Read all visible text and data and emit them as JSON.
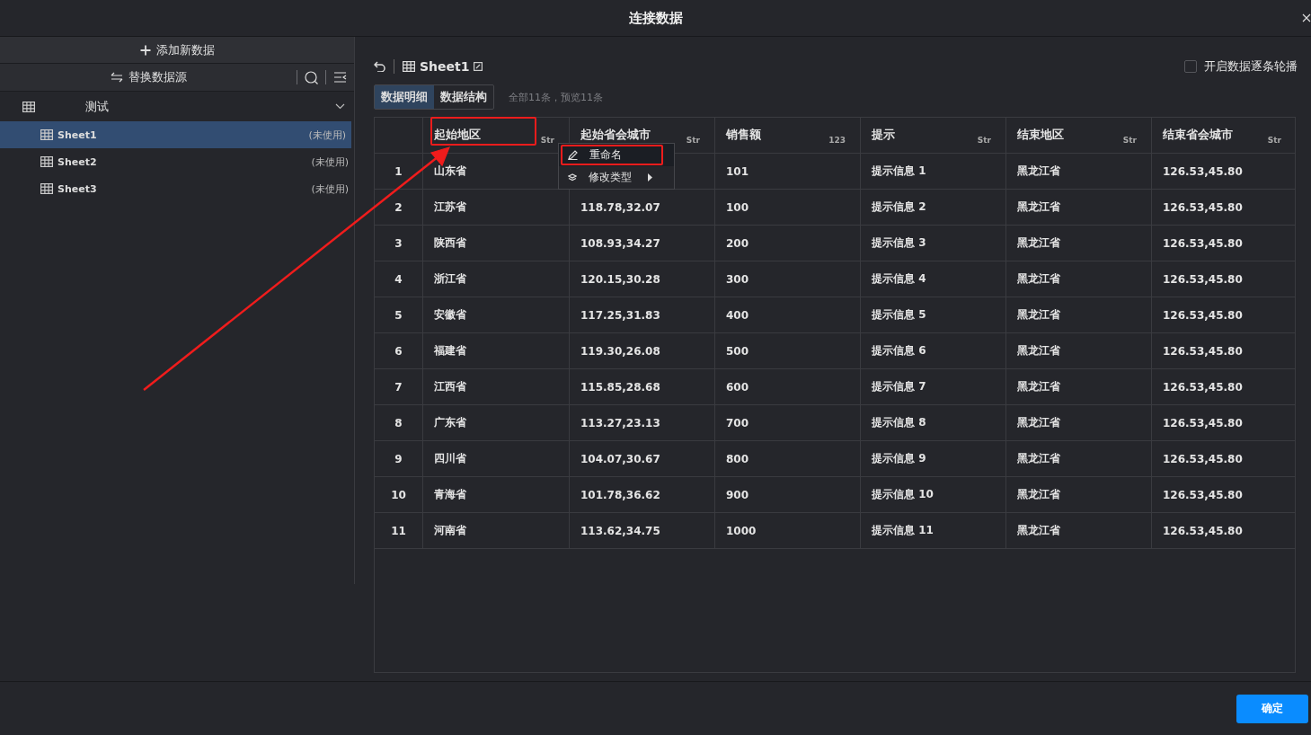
{
  "window": {
    "title": "连接数据"
  },
  "sidebar": {
    "add_button": "添加新数据",
    "replace_button": "替换数据源",
    "group": {
      "label": "测试",
      "expanded": true,
      "children": [
        {
          "label": "Sheet1",
          "status": "(未使用)",
          "selected": true
        },
        {
          "label": "Sheet2",
          "status": "(未使用)",
          "selected": false
        },
        {
          "label": "Sheet3",
          "status": "(未使用)",
          "selected": false
        }
      ]
    }
  },
  "toolbar": {
    "sheet_name": "Sheet1",
    "carousel": {
      "label": "开启数据逐条轮播",
      "checked": false
    }
  },
  "tabs": [
    {
      "label": "数据明细",
      "selected": true
    },
    {
      "label": "数据结构",
      "selected": false
    }
  ],
  "summary": "全部11条，预览11条",
  "table": {
    "columns": [
      {
        "label": "起始地区",
        "type": "Str",
        "highlighted": true
      },
      {
        "label": "起始省会城市",
        "type": "Str",
        "highlighted": false
      },
      {
        "label": "销售额",
        "type": "123",
        "highlighted": false
      },
      {
        "label": "提示",
        "type": "Str",
        "highlighted": false
      },
      {
        "label": "结束地区",
        "type": "Str",
        "highlighted": false
      },
      {
        "label": "结束省会城市",
        "type": "Str",
        "highlighted": false
      }
    ],
    "rows": [
      {
        "index": "1",
        "cells": [
          "山东省",
          null,
          "101",
          "提示信息 1",
          "黑龙江省",
          "126.53,45.80"
        ]
      },
      {
        "index": "2",
        "cells": [
          "江苏省",
          "118.78,32.07",
          "100",
          "提示信息 2",
          "黑龙江省",
          "126.53,45.80"
        ]
      },
      {
        "index": "3",
        "cells": [
          "陕西省",
          "108.93,34.27",
          "200",
          "提示信息 3",
          "黑龙江省",
          "126.53,45.80"
        ]
      },
      {
        "index": "4",
        "cells": [
          "浙江省",
          "120.15,30.28",
          "300",
          "提示信息 4",
          "黑龙江省",
          "126.53,45.80"
        ]
      },
      {
        "index": "5",
        "cells": [
          "安徽省",
          "117.25,31.83",
          "400",
          "提示信息 5",
          "黑龙江省",
          "126.53,45.80"
        ]
      },
      {
        "index": "6",
        "cells": [
          "福建省",
          "119.30,26.08",
          "500",
          "提示信息 6",
          "黑龙江省",
          "126.53,45.80"
        ]
      },
      {
        "index": "7",
        "cells": [
          "江西省",
          "115.85,28.68",
          "600",
          "提示信息 7",
          "黑龙江省",
          "126.53,45.80"
        ]
      },
      {
        "index": "8",
        "cells": [
          "广东省",
          "113.27,23.13",
          "700",
          "提示信息 8",
          "黑龙江省",
          "126.53,45.80"
        ]
      },
      {
        "index": "9",
        "cells": [
          "四川省",
          "104.07,30.67",
          "800",
          "提示信息 9",
          "黑龙江省",
          "126.53,45.80"
        ]
      },
      {
        "index": "10",
        "cells": [
          "青海省",
          "101.78,36.62",
          "900",
          "提示信息 10",
          "黑龙江省",
          "126.53,45.80"
        ]
      },
      {
        "index": "11",
        "cells": [
          "河南省",
          "113.62,34.75",
          "1000",
          "提示信息 11",
          "黑龙江省",
          "126.53,45.80"
        ]
      }
    ]
  },
  "context_menu": {
    "items": [
      {
        "kind": "rename",
        "label": "重命名",
        "highlighted": true,
        "submenu": false
      },
      {
        "kind": "type",
        "label": "修改类型",
        "highlighted": false,
        "submenu": true
      }
    ]
  },
  "annotation": {
    "arrow": true
  },
  "confirm_button": "确定"
}
